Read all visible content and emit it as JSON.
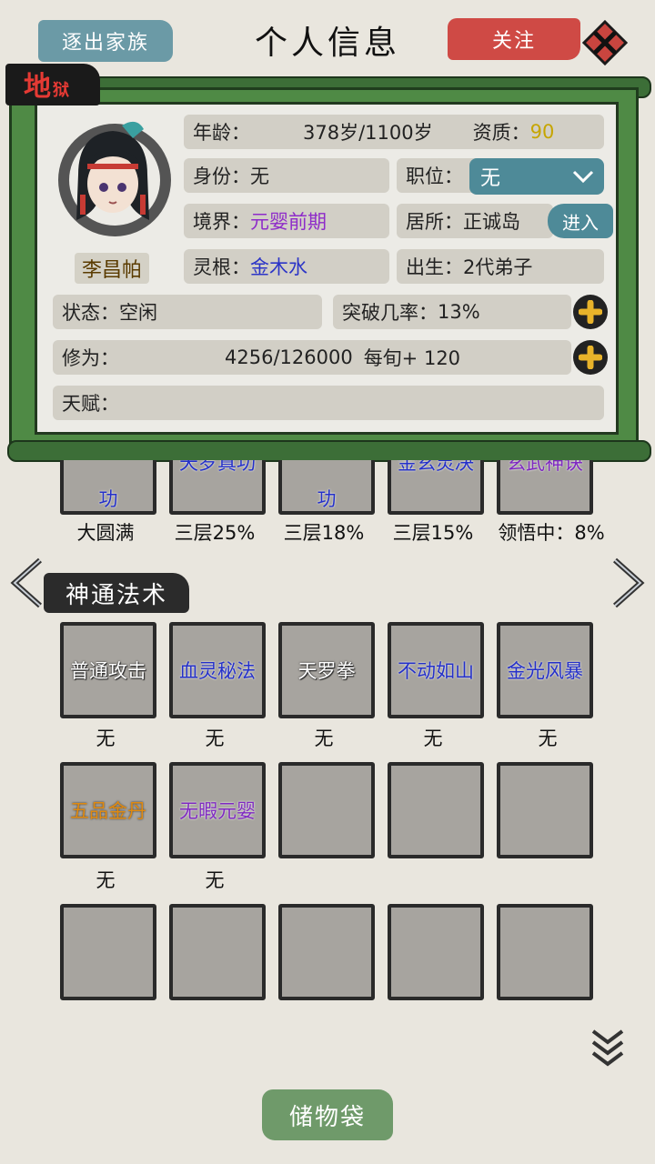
{
  "header": {
    "expel_label": "逐出家族",
    "title": "个人信息",
    "follow_label": "关注"
  },
  "profile": {
    "rank_big": "地",
    "rank_small": "狱",
    "name": "李昌帕",
    "age_label": "年龄：",
    "age_value": "378岁/1100岁",
    "aptitude_label": "资质：",
    "aptitude_value": "90",
    "identity_label": "身份：",
    "identity_value": "无",
    "position_label": "职位：",
    "position_value": "无",
    "realm_label": "境界：",
    "realm_value": "元婴前期",
    "residence_label": "居所：",
    "residence_value": "正诚岛",
    "enter_label": "进入",
    "root_label": "灵根：",
    "root_value": "金木水",
    "birth_label": "出生：",
    "birth_value": "2代弟子",
    "status_label": "状态：",
    "status_value": "空闲",
    "breakthrough_label": "突破几率：",
    "breakthrough_value": "13%",
    "cultivation_label": "修为：",
    "cultivation_value": "4256/126000",
    "per_turn": "每旬+ 120",
    "talent_label": "天赋："
  },
  "techniques": {
    "items": [
      {
        "name": "功",
        "level": "大圆满"
      },
      {
        "name": "天罗真功",
        "level": "三层25%"
      },
      {
        "name": "功",
        "level": "三层18%"
      },
      {
        "name": "金玄灵决",
        "level": "三层15%"
      },
      {
        "name": "玄武神诀",
        "level": "领悟中：8%"
      }
    ]
  },
  "spells": {
    "section_title": "神通法术",
    "row1": [
      {
        "name": "普通攻击",
        "level": "无"
      },
      {
        "name": "血灵秘法",
        "level": "无"
      },
      {
        "name": "天罗拳",
        "level": "无"
      },
      {
        "name": "不动如山",
        "level": "无"
      },
      {
        "name": "金光风暴",
        "level": "无"
      }
    ],
    "row2": [
      {
        "name": "五品金丹",
        "level": "无"
      },
      {
        "name": "无暇元婴",
        "level": "无"
      }
    ]
  },
  "footer": {
    "storage_label": "储物袋"
  },
  "colors": {
    "accent_teal": "#4e8a98",
    "follow_red": "#cf4a45",
    "scroll_green": "#4f8a45",
    "rank_red": "#e53a34"
  }
}
